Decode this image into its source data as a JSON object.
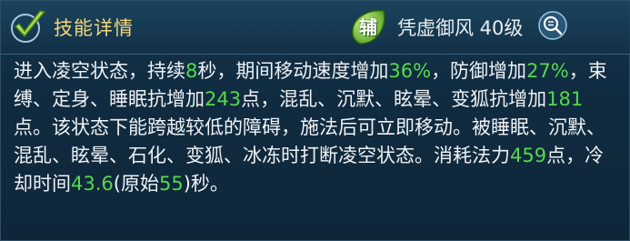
{
  "header": {
    "title": "技能详情",
    "badge": "辅",
    "skill_name": "凭虚御风 40级"
  },
  "description": {
    "t1": "进入凌空状态，持续",
    "n1": "8",
    "t2": "秒，期间移动速度增加",
    "n2": "36%",
    "t3": "，防御增加",
    "n3": "27%",
    "t4": "，束缚、定身、睡眠抗增加",
    "n4": "243",
    "t5": "点，混乱、沉默、眩晕、变狐抗增加",
    "n5": "181",
    "t6": "点。该状态下能跨越较低的障碍，施法后可立即移动。被睡眠、沉默、混乱、眩晕、石化、变狐、冰冻时打断凌空状态。消耗法力",
    "n6": "459",
    "t7": "点，冷却时间",
    "n7": "43.6",
    "t8": "(原始",
    "n8": "55",
    "t9": ")秒。"
  },
  "colors": {
    "title": "#f4d77a",
    "highlight": "#54d94c",
    "text": "#eef2f5"
  },
  "icons": {
    "left": "checkmark-icon",
    "badge": "leaf-badge-icon",
    "right": "magnifier-icon"
  }
}
